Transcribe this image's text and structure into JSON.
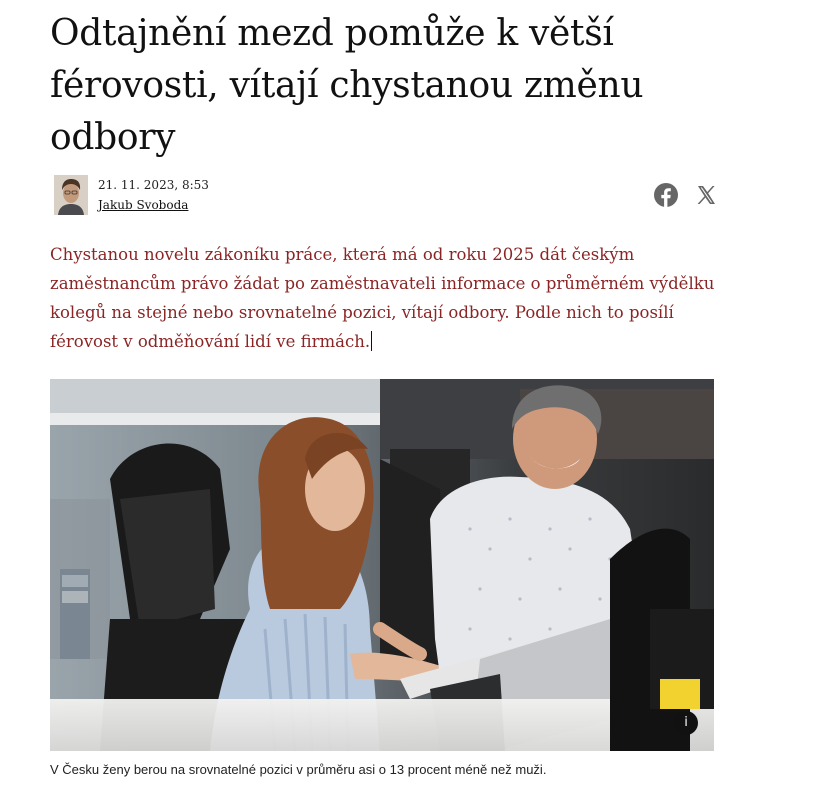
{
  "article": {
    "headline": "Odtajnění mezd pomůže k větší férovosti, vítají chystanou změnu odbory",
    "date": "21. 11. 2023, 8:53",
    "author": "Jakub Svoboda",
    "lead": "Chystanou novelu zákoníku práce, která má od roku 2025 dát českým zaměstnancům právo žádat po zaměstnavateli informace o průměrném výdělku kolegů na stejné nebo srovnatelné pozici, vítají odbory. Podle nich to posílí férovost v odměňování lidí ve firmách.",
    "caption": "V Česku ženy berou na srovnatelné pozici v průměru asi o 13 procent méně než muži.",
    "info_icon_glyph": "i"
  },
  "share": {
    "icons": [
      "facebook-icon",
      "x-icon"
    ],
    "facebook_color": "#666666",
    "x_color": "#666666"
  },
  "colors": {
    "headline": "#111111",
    "lead": "#8b2525",
    "caption": "#222222"
  }
}
